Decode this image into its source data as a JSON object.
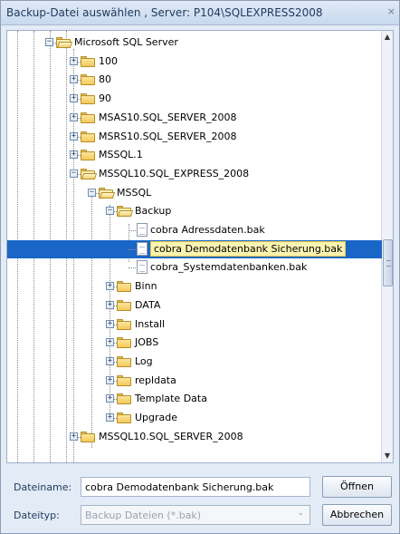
{
  "window": {
    "title": "Backup-Datei auswählen , Server: P104\\SQLEXPRESS2008",
    "close_glyph": "×"
  },
  "tree": {
    "nodes": [
      {
        "label": "Microsoft SQL Server",
        "level": 0,
        "expander": "−",
        "icon": "folder-open-icon"
      },
      {
        "label": "100",
        "level": 1,
        "expander": "+",
        "icon": "folder-icon"
      },
      {
        "label": "80",
        "level": 1,
        "expander": "+",
        "icon": "folder-icon"
      },
      {
        "label": "90",
        "level": 1,
        "expander": "+",
        "icon": "folder-icon"
      },
      {
        "label": "MSAS10.SQL_SERVER_2008",
        "level": 1,
        "expander": "+",
        "icon": "folder-icon"
      },
      {
        "label": "MSRS10.SQL_SERVER_2008",
        "level": 1,
        "expander": "+",
        "icon": "folder-icon"
      },
      {
        "label": "MSSQL.1",
        "level": 1,
        "expander": "+",
        "icon": "folder-icon"
      },
      {
        "label": "MSSQL10.SQL_EXPRESS_2008",
        "level": 1,
        "expander": "−",
        "icon": "folder-open-icon"
      },
      {
        "label": "MSSQL",
        "level": 2,
        "expander": "−",
        "icon": "folder-open-icon"
      },
      {
        "label": "Backup",
        "level": 3,
        "expander": "−",
        "icon": "folder-open-icon"
      },
      {
        "label": "cobra Adressdaten.bak",
        "level": 4,
        "expander": "",
        "icon": "file-icon"
      },
      {
        "label": "cobra Demodatenbank Sicherung.bak",
        "level": 4,
        "expander": "",
        "icon": "file-icon",
        "selected": true
      },
      {
        "label": "cobra_Systemdatenbanken.bak",
        "level": 4,
        "expander": "",
        "icon": "file-icon"
      },
      {
        "label": "Binn",
        "level": 3,
        "expander": "+",
        "icon": "folder-icon"
      },
      {
        "label": "DATA",
        "level": 3,
        "expander": "+",
        "icon": "folder-icon"
      },
      {
        "label": "Install",
        "level": 3,
        "expander": "+",
        "icon": "folder-icon"
      },
      {
        "label": "JOBS",
        "level": 3,
        "expander": "+",
        "icon": "folder-icon"
      },
      {
        "label": "Log",
        "level": 3,
        "expander": "+",
        "icon": "folder-icon"
      },
      {
        "label": "repldata",
        "level": 3,
        "expander": "+",
        "icon": "folder-icon"
      },
      {
        "label": "Template Data",
        "level": 3,
        "expander": "+",
        "icon": "folder-icon"
      },
      {
        "label": "Upgrade",
        "level": 3,
        "expander": "+",
        "icon": "folder-icon"
      },
      {
        "label": "MSSQL10.SQL_SERVER_2008",
        "level": 1,
        "expander": "+",
        "icon": "folder-icon"
      }
    ]
  },
  "scrollbar": {
    "up_glyph": "▲",
    "down_glyph": "▼"
  },
  "footer": {
    "filename_label": "Dateiname:",
    "filename_value": "cobra Demodatenbank Sicherung.bak",
    "filetype_label": "Dateityp:",
    "filetype_value": "Backup Dateien (*.bak)",
    "dropdown_glyph": "⌄",
    "open_button": "Öffnen",
    "cancel_button": "Abbrechen"
  }
}
